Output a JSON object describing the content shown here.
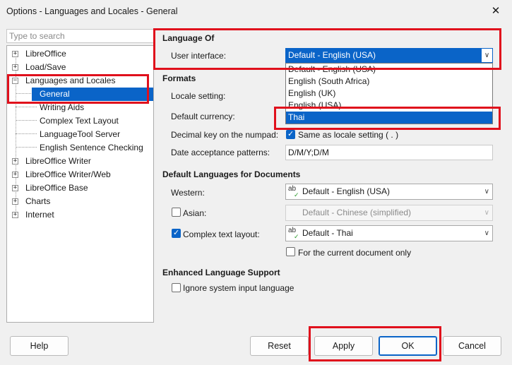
{
  "window": {
    "title": "Options - Languages and Locales - General",
    "close_glyph": "✕"
  },
  "search": {
    "placeholder": "Type to search"
  },
  "tree": {
    "items": [
      {
        "label": "LibreOffice",
        "expander": "+"
      },
      {
        "label": "Load/Save",
        "expander": "+"
      },
      {
        "label": "Languages and Locales",
        "expander": "−"
      },
      {
        "label": "General"
      },
      {
        "label": "Writing Aids"
      },
      {
        "label": "Complex Text Layout"
      },
      {
        "label": "LanguageTool Server"
      },
      {
        "label": "English Sentence Checking"
      },
      {
        "label": "LibreOffice Writer",
        "expander": "+"
      },
      {
        "label": "LibreOffice Writer/Web",
        "expander": "+"
      },
      {
        "label": "LibreOffice Base",
        "expander": "+"
      },
      {
        "label": "Charts",
        "expander": "+"
      },
      {
        "label": "Internet",
        "expander": "+"
      }
    ]
  },
  "language_of": {
    "title": "Language Of",
    "ui_label": "User interface:",
    "ui_value": "Default - English (USA)",
    "dropdown_items": [
      "Default - English (USA)",
      "English (South Africa)",
      "English (UK)",
      "English (USA)",
      "Thai"
    ]
  },
  "formats": {
    "title": "Formats",
    "locale_label": "Locale setting:",
    "currency_label": "Default currency:",
    "decimal_label": "Decimal key on the numpad:",
    "decimal_check_label": "Same as locale setting ( . )",
    "date_label": "Date acceptance patterns:",
    "date_value": "D/M/Y;D/M"
  },
  "default_languages": {
    "title": "Default Languages for Documents",
    "western_label": "Western:",
    "western_value": "Default - English (USA)",
    "asian_label": "Asian:",
    "asian_value": "Default - Chinese (simplified)",
    "ctl_label": "Complex text layout:",
    "ctl_value": "Default - Thai",
    "current_doc_label": "For the current document only"
  },
  "enhanced": {
    "title": "Enhanced Language Support",
    "ignore_label": "Ignore system input language"
  },
  "buttons": {
    "help": "Help",
    "reset": "Reset",
    "apply": "Apply",
    "ok": "OK",
    "cancel": "Cancel"
  },
  "icons": {
    "lang_icon_text": "ab",
    "lang_icon_tick": "✓",
    "chevron": "∨"
  },
  "colors": {
    "accent": "#0a64c8",
    "highlight_box": "#e0101c"
  }
}
